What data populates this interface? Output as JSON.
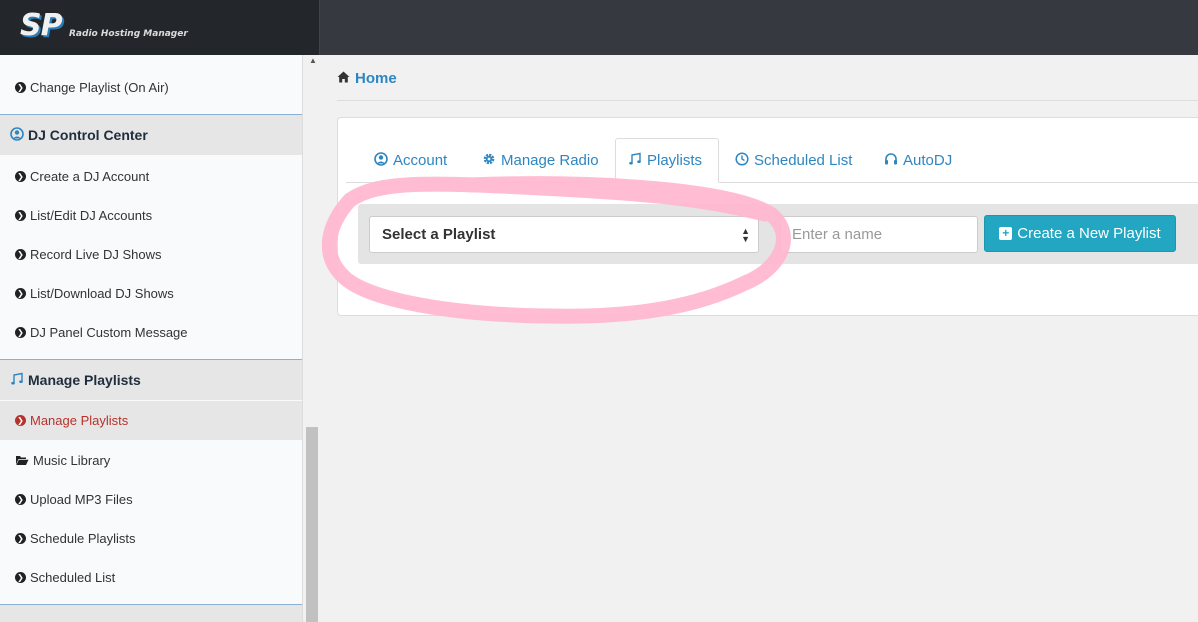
{
  "logo": {
    "mark": "SP",
    "subtitle": "Radio Hosting Manager"
  },
  "sidebar": {
    "items_top": [
      {
        "label": "Change Playlist (On Air)",
        "icon": "circle-arrow-right-icon"
      }
    ],
    "section_dj": {
      "label": "DJ Control Center",
      "icon": "user-circle-icon"
    },
    "items_dj": [
      {
        "label": "Create a DJ Account",
        "icon": "circle-arrow-right-icon"
      },
      {
        "label": "List/Edit DJ Accounts",
        "icon": "circle-arrow-right-icon"
      },
      {
        "label": "Record Live DJ Shows",
        "icon": "circle-arrow-right-icon"
      },
      {
        "label": "List/Download DJ Shows",
        "icon": "circle-arrow-right-icon"
      },
      {
        "label": "DJ Panel Custom Message",
        "icon": "circle-arrow-right-icon"
      }
    ],
    "section_playlists": {
      "label": "Manage Playlists",
      "icon": "music-note-icon"
    },
    "items_playlists": [
      {
        "label": "Manage Playlists",
        "icon": "circle-arrow-right-icon",
        "active": true,
        "active_color": "#b7322c"
      },
      {
        "label": "Music Library",
        "icon": "folder-open-icon"
      },
      {
        "label": "Upload MP3 Files",
        "icon": "circle-arrow-right-icon"
      },
      {
        "label": "Schedule Playlists",
        "icon": "circle-arrow-right-icon"
      },
      {
        "label": "Scheduled List",
        "icon": "circle-arrow-right-icon"
      }
    ]
  },
  "breadcrumb": {
    "home_label": "Home",
    "icon": "home-icon"
  },
  "tabs": [
    {
      "label": "Account",
      "icon": "user-circle-icon"
    },
    {
      "label": "Manage Radio",
      "icon": "gear-icon"
    },
    {
      "label": "Playlists",
      "icon": "music-note-icon",
      "active": true
    },
    {
      "label": "Scheduled List",
      "icon": "clock-icon"
    },
    {
      "label": "AutoDJ",
      "icon": "headphones-icon"
    }
  ],
  "playlist_form": {
    "select_value": "Select a Playlist",
    "name_placeholder": "Enter a name",
    "create_label": "Create a New Playlist"
  },
  "colors": {
    "accent": "#2e86c1",
    "button": "#22a6c1",
    "active_item": "#b7322c",
    "annotation": "#ffb6cf"
  }
}
